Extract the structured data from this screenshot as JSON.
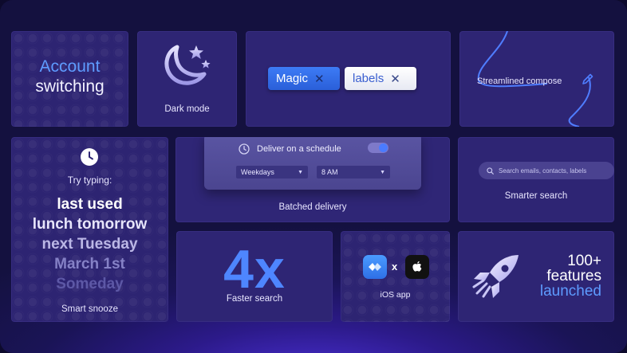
{
  "account": {
    "highlight": "Account",
    "rest": "switching"
  },
  "dark_mode": {
    "label": "Dark mode"
  },
  "labels_card": {
    "chips": [
      {
        "label": "Magic"
      },
      {
        "label": "labels"
      }
    ]
  },
  "compose": {
    "label": "Streamlined compose"
  },
  "snooze": {
    "prompt": "Try typing:",
    "examples": [
      "last used",
      "lunch tomorrow",
      "next Tuesday",
      "March 1st",
      "Someday"
    ],
    "label": "Smart snooze"
  },
  "schedule": {
    "title": "Deliver on a schedule",
    "days": "Weekdays",
    "time": "8 AM",
    "toggle_on": true,
    "label": "Batched delivery"
  },
  "search": {
    "placeholder": "Search emails, contacts, labels",
    "label": "Smarter search"
  },
  "faster": {
    "big": "4x",
    "label": "Faster search"
  },
  "ios": {
    "separator": "x",
    "label": "iOS app"
  },
  "features": {
    "count": "100+",
    "word": "features",
    "highlight": "launched"
  },
  "colors": {
    "accent": "#4e86ff",
    "card": "#2e2574",
    "background": "#14113f"
  }
}
